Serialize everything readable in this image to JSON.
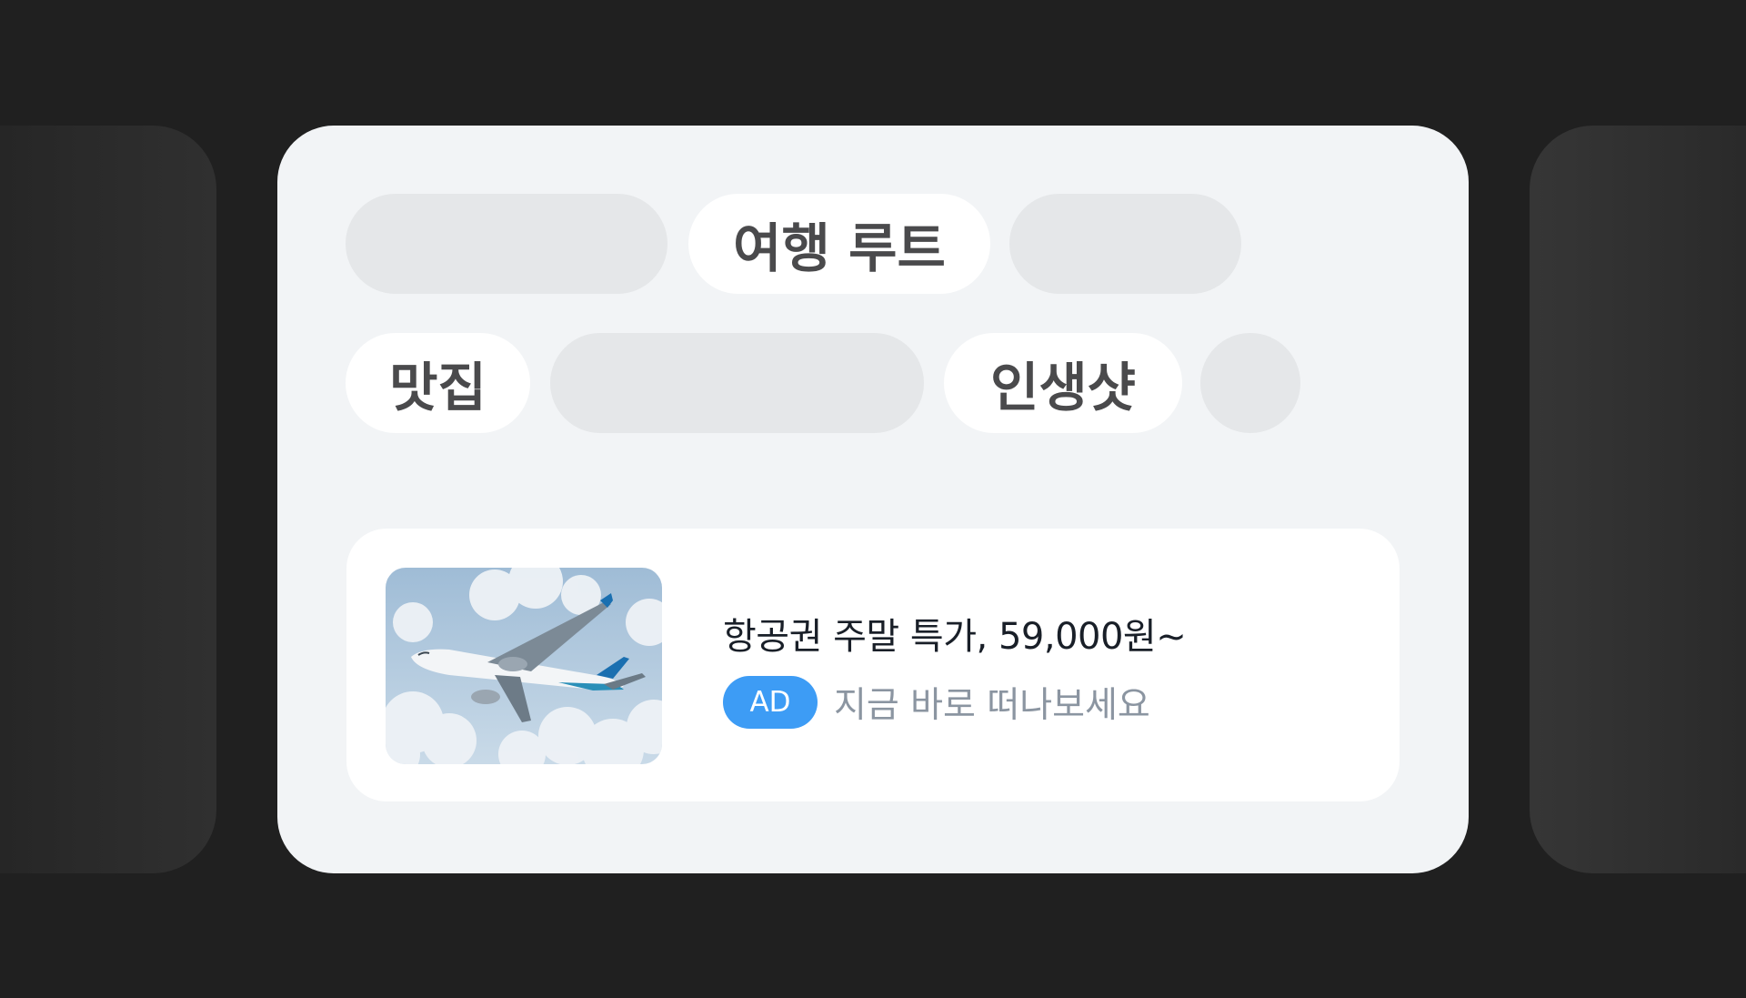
{
  "colors": {
    "background": "#202020",
    "card": "#f2f4f6",
    "chip_placeholder": "#e5e7e9",
    "chip_label_bg": "#ffffff",
    "chip_text": "#4a4a4c",
    "ad_badge": "#3d9cf5",
    "ad_title": "#191f28",
    "ad_subtitle": "#8b95a1"
  },
  "chips": {
    "row1": {
      "label": "여행 루트"
    },
    "row2": {
      "label_a": "맛집",
      "label_b": "인생샷"
    }
  },
  "ad": {
    "image_icon": "airplane-photo",
    "title": "항공권 주말 특가, 59,000원~",
    "badge": "AD",
    "subtitle": "지금 바로 떠나보세요"
  }
}
